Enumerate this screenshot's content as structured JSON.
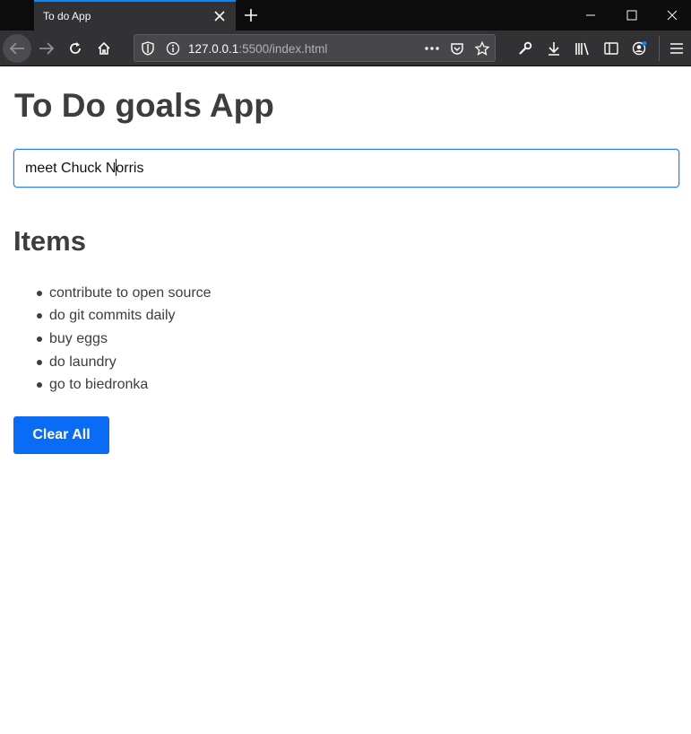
{
  "browser": {
    "tab_title": "To do App",
    "url_host": "127.0.0.1",
    "url_rest": ":5500/index.html"
  },
  "page": {
    "title": "To Do goals App",
    "input_value": "meet Chuck Norris",
    "items_heading": "Items",
    "items": [
      "contribute to open source",
      "do git commits daily",
      "buy eggs",
      "do laundry",
      "go to biedronka"
    ],
    "clear_button_label": "Clear All"
  },
  "colors": {
    "accent": "#0a84ff",
    "button": "#0a6cf5",
    "text": "#3d3d3d"
  },
  "icons": [
    "close-icon",
    "plus-icon",
    "minimize-icon",
    "maximize-icon",
    "window-close-icon",
    "back-arrow-icon",
    "forward-arrow-icon",
    "reload-icon",
    "home-icon",
    "shield-icon",
    "info-icon",
    "more-icon",
    "pocket-icon",
    "star-icon",
    "wrench-icon",
    "download-icon",
    "library-icon",
    "sidebar-icon",
    "account-icon",
    "menu-icon"
  ]
}
